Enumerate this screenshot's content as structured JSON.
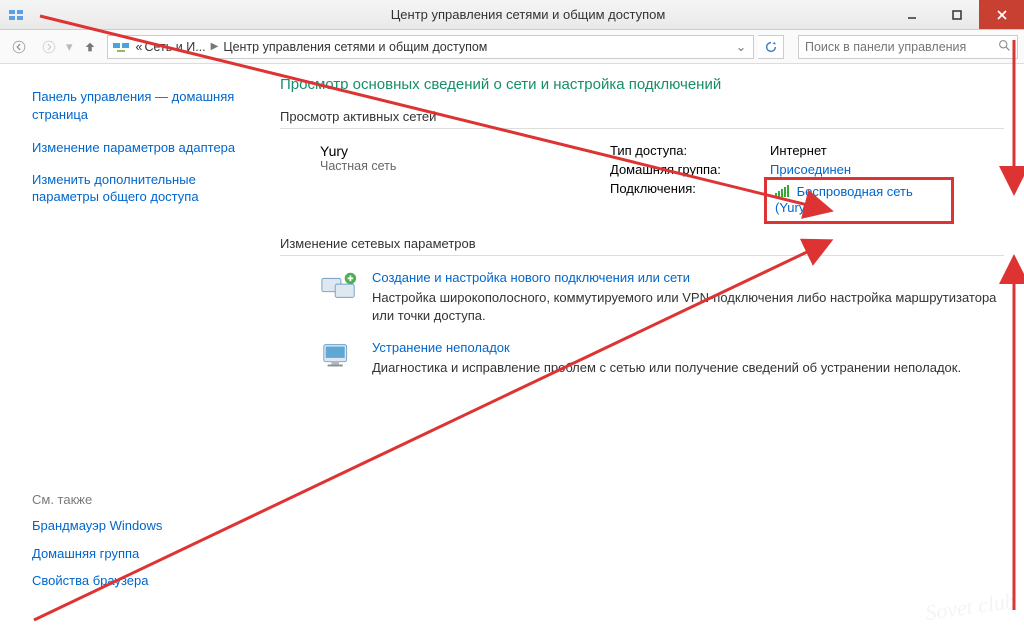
{
  "window": {
    "title": "Центр управления сетями и общим доступом"
  },
  "breadcrumb": {
    "root_prefix": "«",
    "root": "Сеть и И...",
    "current": "Центр управления сетями и общим доступом"
  },
  "search": {
    "placeholder": "Поиск в панели управления"
  },
  "sidebar": {
    "home": "Панель управления — домашняя страница",
    "links": [
      "Изменение параметров адаптера",
      "Изменить дополнительные параметры общего доступа"
    ]
  },
  "see_also": {
    "header": "См. также",
    "links": [
      "Брандмауэр Windows",
      "Домашняя группа",
      "Свойства браузера"
    ]
  },
  "main": {
    "heading": "Просмотр основных сведений о сети и настройка подключений",
    "active_title": "Просмотр активных сетей",
    "network": {
      "name": "Yury",
      "subtype": "Частная сеть",
      "rows": {
        "access_label": "Тип доступа:",
        "access_value": "Интернет",
        "group_label": "Домашняя группа:",
        "group_value": "Присоединен",
        "conn_label": "Подключения:",
        "conn_link": "Беспроводная сеть",
        "conn_paren": "(Yury)"
      }
    },
    "change_title": "Изменение сетевых параметров",
    "tasks": [
      {
        "title": "Создание и настройка нового подключения или сети",
        "desc": "Настройка широкополосного, коммутируемого или VPN-подключения либо настройка маршрутизатора или точки доступа."
      },
      {
        "title": "Устранение неполадок",
        "desc": "Диагностика и исправление проблем с сетью или получение сведений об устранении неполадок."
      }
    ]
  },
  "watermark": "Sovet club"
}
